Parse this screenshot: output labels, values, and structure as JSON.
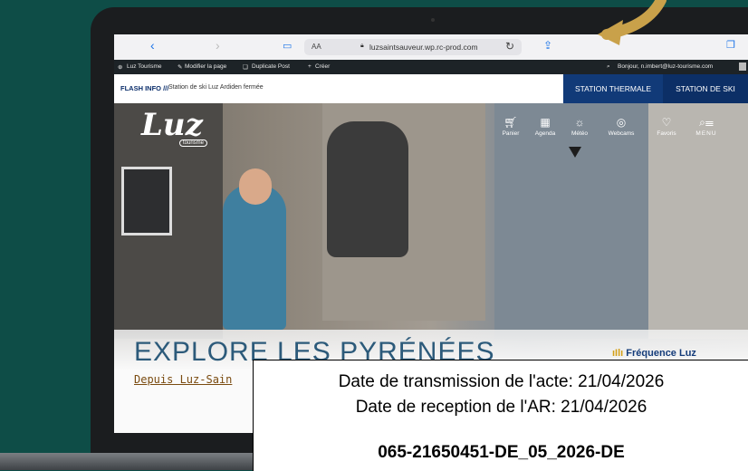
{
  "browser": {
    "text_size_label": "AA",
    "url": "luzsaintsauveur.wp.rc-prod.com"
  },
  "admin_bar": {
    "site_name": "Luz Tourisme",
    "edit_page": "Modifier la page",
    "duplicate_post": "Duplicate Post",
    "create": "Créer",
    "greeting": "Bonjour, n.imbert@luz-tourisme.com"
  },
  "flash": {
    "title": "FLASH INFO ///",
    "text": "Station de ski Luz Ardiden fermée",
    "button_thermale": "STATION THERMALE",
    "button_ski": "STATION DE SKI"
  },
  "logo": {
    "main": "Luz",
    "sub": "tourisme"
  },
  "header_nav": [
    {
      "icon": "cart-icon",
      "label": "Panier"
    },
    {
      "icon": "calendar-icon",
      "label": "Agenda"
    },
    {
      "icon": "sun-icon",
      "label": "Météo"
    },
    {
      "icon": "webcam-icon",
      "label": "Webcams"
    },
    {
      "icon": "heart-icon",
      "label": "Favoris"
    },
    {
      "icon": "search-menu-icon",
      "label": "MENU"
    }
  ],
  "hero": {
    "title": "EXPLORE LES PYRÉNÉES",
    "subtitle": "Depuis Luz-Sain",
    "radio": "Fréquence Luz"
  },
  "stamp": {
    "line1": "Date de transmission de l'acte: 21/04/2026",
    "line2": "Date de reception de l'AR: 21/04/2026",
    "line3": "065-21650451-DE_05_2026-DE"
  },
  "colors": {
    "background": "#0e4d47",
    "navy": "#113a78",
    "admin_bar": "#1d2327",
    "arrow": "#c9a14a"
  }
}
